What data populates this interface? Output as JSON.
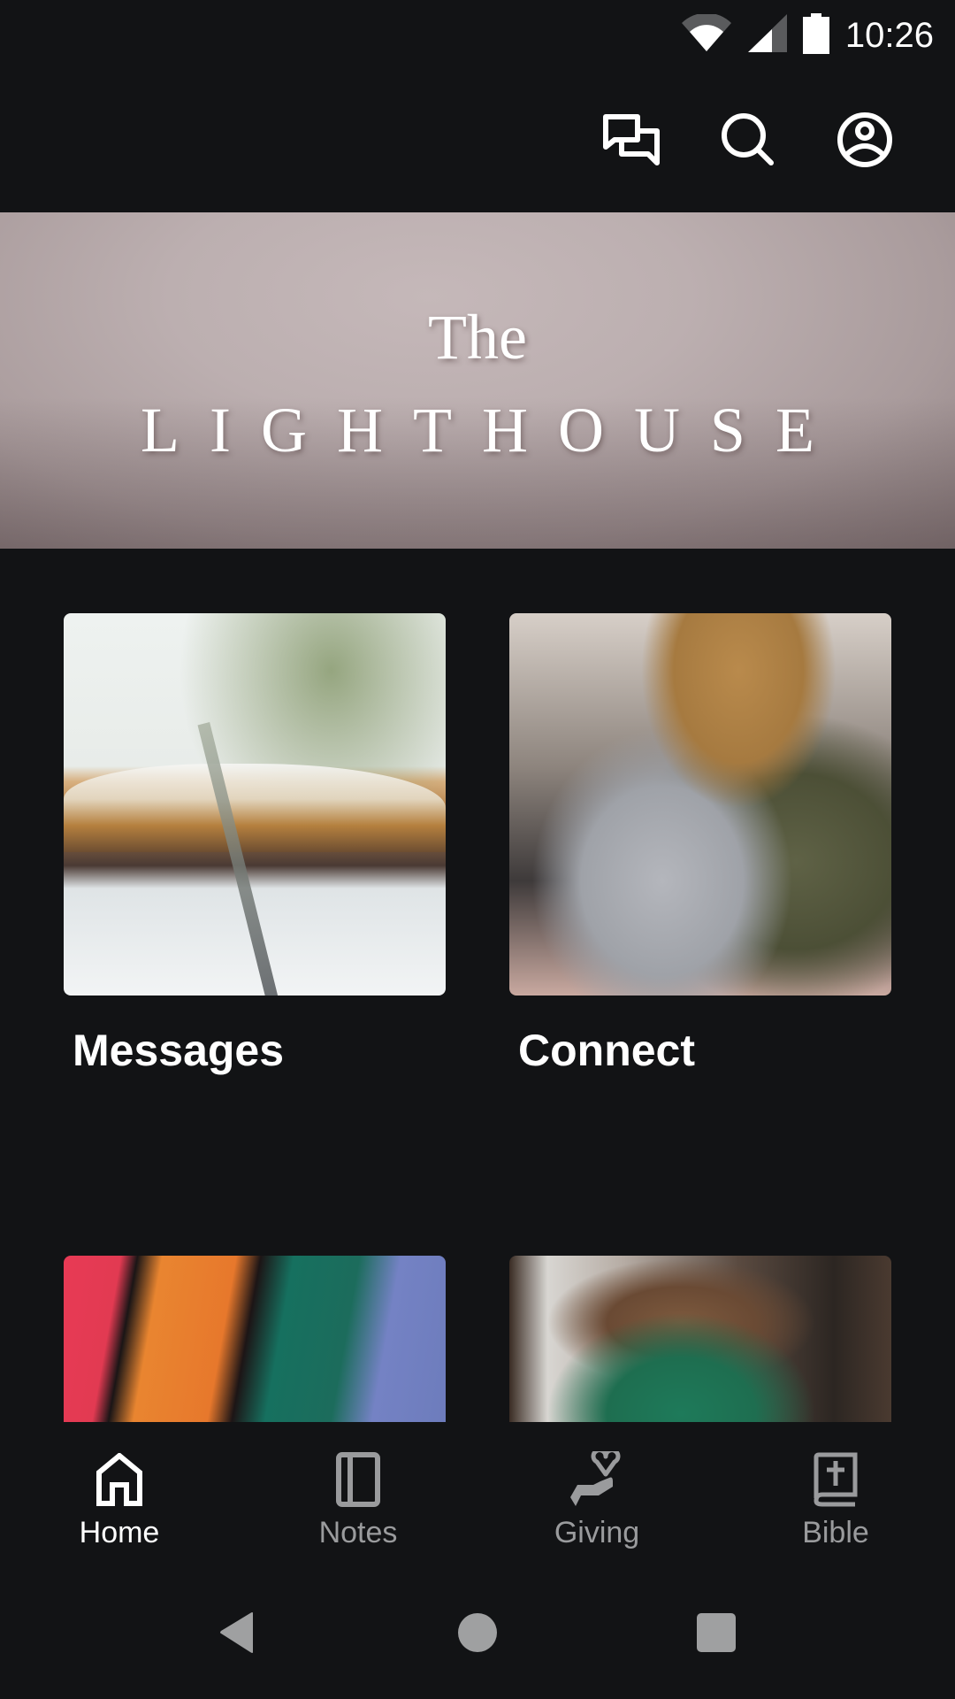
{
  "status_bar": {
    "time": "10:26",
    "icons": [
      "wifi-icon",
      "cellular-signal-icon",
      "battery-icon"
    ]
  },
  "app_bar": {
    "actions": [
      {
        "name": "chat-icon",
        "label": "Messages"
      },
      {
        "name": "search-icon",
        "label": "Search"
      },
      {
        "name": "profile-icon",
        "label": "Profile"
      }
    ]
  },
  "banner": {
    "line1": "The",
    "line2": "LIGHTHOUSE"
  },
  "tiles": [
    {
      "label": "Messages",
      "image": "open bible with plant"
    },
    {
      "label": "Connect",
      "image": "two men hugging in a crowd"
    },
    {
      "label": "",
      "image": "hands in colorful knit sleeves"
    },
    {
      "label": "",
      "image": "women with hand on shoulder"
    }
  ],
  "bottom_nav": {
    "items": [
      {
        "label": "Home",
        "icon": "home-icon",
        "active": true
      },
      {
        "label": "Notes",
        "icon": "notes-icon",
        "active": false
      },
      {
        "label": "Giving",
        "icon": "giving-icon",
        "active": false
      },
      {
        "label": "Bible",
        "icon": "bible-icon",
        "active": false
      }
    ]
  },
  "system_nav": {
    "buttons": [
      "back-icon",
      "home-circle-icon",
      "recents-icon"
    ]
  },
  "colors": {
    "background": "#121315",
    "active": "#ffffff",
    "inactive": "#9a9b9d"
  }
}
